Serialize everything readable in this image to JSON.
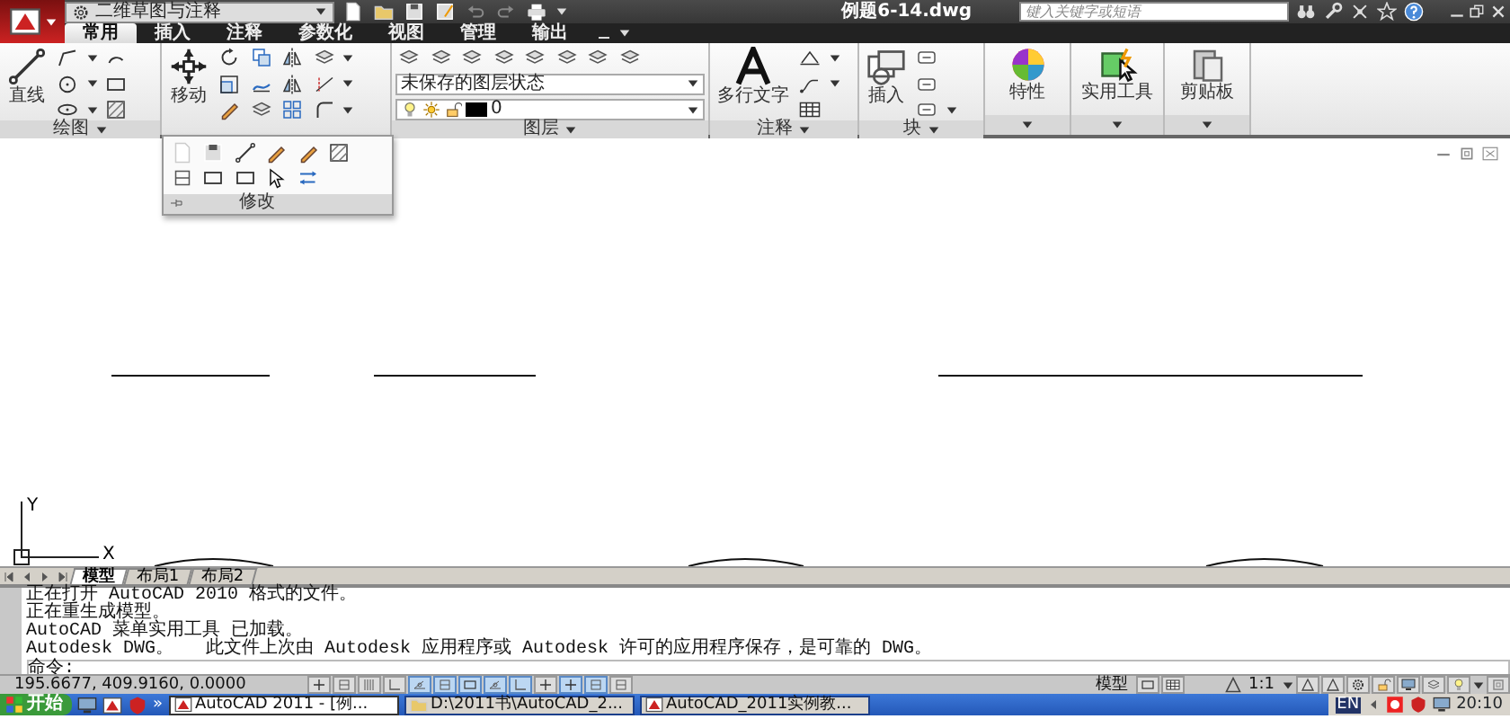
{
  "title_bar": {
    "workspace": "二维草图与注释",
    "document_title": "例题6-14.dwg",
    "search": {
      "placeholder": "键入关键字或短语"
    }
  },
  "ribbon_tabs": [
    {
      "label": "常用",
      "selected": true
    },
    {
      "label": "插入",
      "selected": false
    },
    {
      "label": "注释",
      "selected": false
    },
    {
      "label": "参数化",
      "selected": false
    },
    {
      "label": "视图",
      "selected": false
    },
    {
      "label": "管理",
      "selected": false
    },
    {
      "label": "输出",
      "selected": false
    }
  ],
  "ribbon_panels": [
    {
      "kind": "tools",
      "title": "绘图",
      "main_tool": "直线",
      "expanded": false
    },
    {
      "kind": "tools",
      "title": "修改",
      "main_tool": "移动",
      "expanded": true
    },
    {
      "kind": "layers",
      "title": "图层",
      "layer_state": "未保存的图层状态",
      "current_layer": "0",
      "expanded": false
    },
    {
      "kind": "tools",
      "title": "注释",
      "main_tool": "多行文字",
      "expanded": false
    },
    {
      "kind": "tools",
      "title": "块",
      "main_tool": "插入",
      "expanded": false
    },
    {
      "kind": "collapsed",
      "main_tool": "特性",
      "expanded": false
    },
    {
      "kind": "collapsed",
      "main_tool": "实用工具",
      "expanded": false
    },
    {
      "kind": "collapsed",
      "main_tool": "剪贴板",
      "expanded": false
    }
  ],
  "ucs_icon": {
    "y_label": "Y",
    "x_label": "X"
  },
  "layout_tabs": [
    {
      "label": "模型",
      "selected": true
    },
    {
      "label": "布局1",
      "selected": false
    },
    {
      "label": "布局2",
      "selected": false
    }
  ],
  "command_history": [
    "正在打开 AutoCAD 2010 格式的文件。",
    "正在重生成模型。",
    "AutoCAD 菜单实用工具 已加载。",
    "Autodesk DWG。   此文件上次由 Autodesk 应用程序或 Autodesk 许可的应用程序保存，是可靠的 DWG。"
  ],
  "command_prompt": "命令:",
  "status_bar": {
    "coordinates": "195.6677, 409.9160, 0.0000",
    "toggles": [
      {
        "on": false
      },
      {
        "on": false
      },
      {
        "on": false
      },
      {
        "on": false
      },
      {
        "on": true
      },
      {
        "on": true
      },
      {
        "on": true
      },
      {
        "on": true
      },
      {
        "on": true
      },
      {
        "on": false
      },
      {
        "on": true
      },
      {
        "on": true
      },
      {
        "on": false
      }
    ],
    "space": "模型",
    "annotation_scale": "1:1"
  },
  "taskbar": {
    "start": "开始",
    "overflow": "»",
    "windows": [
      {
        "label": "AutoCAD 2011 - [例...",
        "selected": true
      },
      {
        "label": "D:\\2011书\\AutoCAD_2...",
        "selected": false
      },
      {
        "label": "AutoCAD_2011实例教...",
        "selected": false
      }
    ],
    "language": "EN",
    "clock": "20:10"
  }
}
